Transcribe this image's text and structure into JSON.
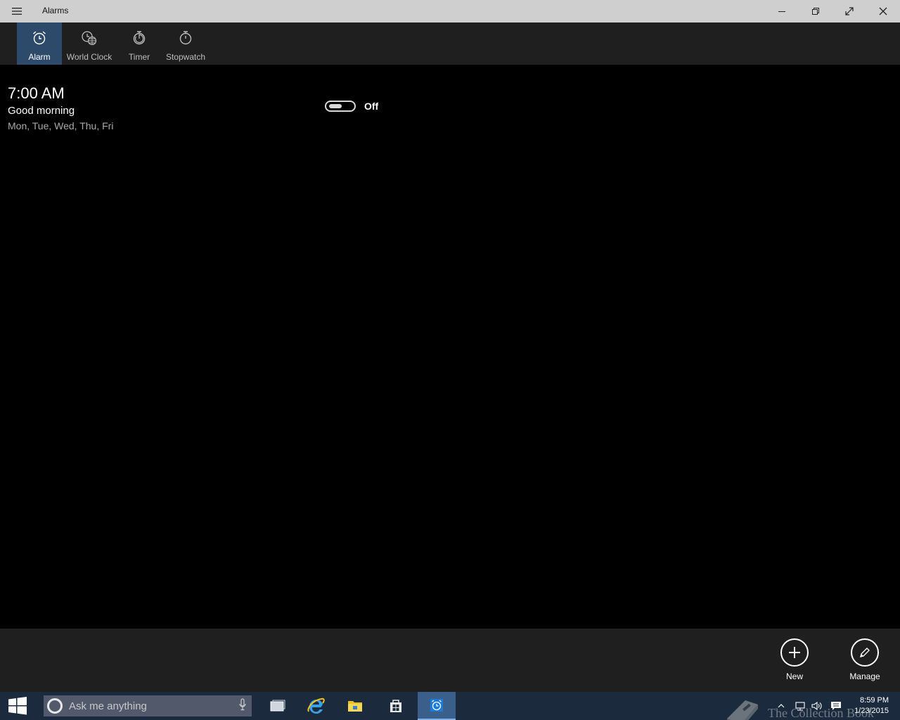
{
  "window": {
    "title": "Alarms",
    "controls": [
      "minimize",
      "restore",
      "fullscreen",
      "close"
    ]
  },
  "tabs": [
    {
      "label": "Alarm",
      "icon": "alarm-clock-icon",
      "active": true
    },
    {
      "label": "World Clock",
      "icon": "world-clock-icon",
      "active": false
    },
    {
      "label": "Timer",
      "icon": "timer-icon",
      "active": false
    },
    {
      "label": "Stopwatch",
      "icon": "stopwatch-icon",
      "active": false
    }
  ],
  "alarm": {
    "time": "7:00 AM",
    "name": "Good morning",
    "days": "Mon, Tue, Wed, Thu, Fri",
    "toggle_label": "Off",
    "enabled": false
  },
  "commands": {
    "new_label": "New",
    "manage_label": "Manage"
  },
  "taskbar": {
    "search_placeholder": "Ask me anything",
    "apps": [
      "task-view-icon",
      "internet-explorer-icon",
      "file-explorer-icon",
      "store-icon",
      "alarms-app-icon"
    ],
    "clock_time": "8:59 PM",
    "clock_date": "1/23/2015"
  },
  "watermark": {
    "text": "The Collection Book"
  },
  "colors": {
    "titlebar": "#cfcfcf",
    "tabbar": "#1f1f1f",
    "active_tab": "#2e4a6b",
    "taskbar": "#1b2a3d",
    "search": "#51596a"
  }
}
